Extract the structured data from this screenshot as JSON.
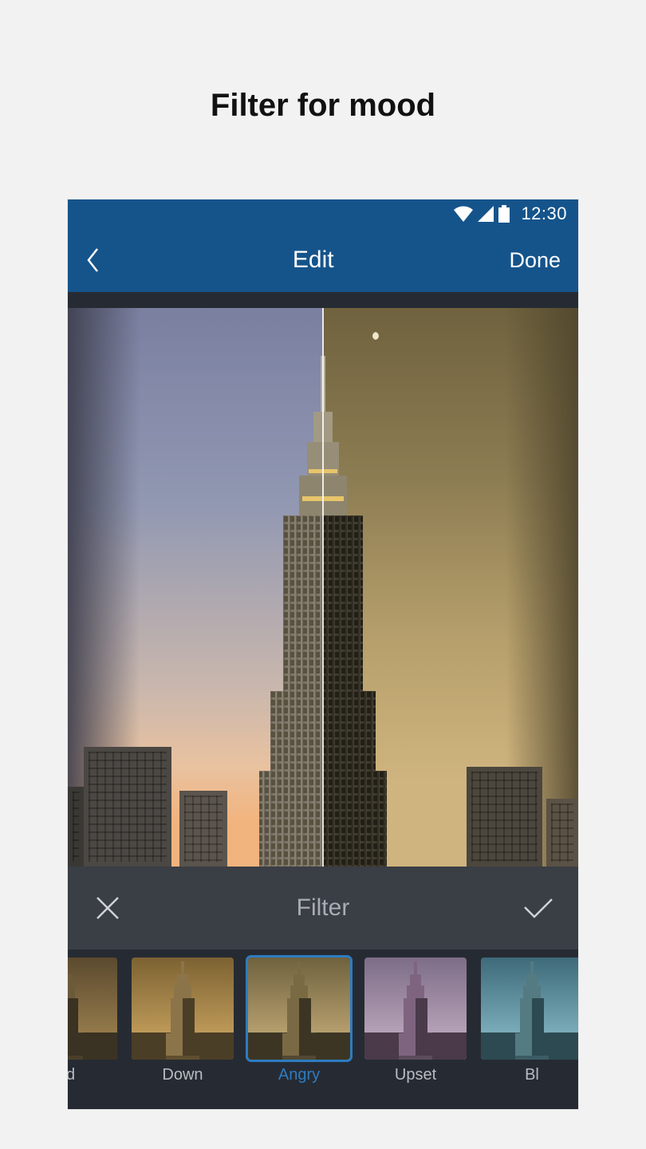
{
  "page": {
    "title": "Filter for mood"
  },
  "statusbar": {
    "time": "12:30"
  },
  "navbar": {
    "title": "Edit",
    "done_label": "Done"
  },
  "filter_toolbar": {
    "label": "Filter"
  },
  "filters": [
    {
      "label": "ad",
      "selected": false,
      "tint": "warm-dark"
    },
    {
      "label": "Down",
      "selected": false,
      "tint": "warm"
    },
    {
      "label": "Angry",
      "selected": true,
      "tint": "yellow"
    },
    {
      "label": "Upset",
      "selected": false,
      "tint": "magenta"
    },
    {
      "label": "Bl",
      "selected": false,
      "tint": "cyan"
    }
  ],
  "colors": {
    "accent": "#2d7cc1",
    "navbar_bg": "#15548b",
    "panel_bg": "#3a3e45",
    "app_bg": "#262b33"
  }
}
